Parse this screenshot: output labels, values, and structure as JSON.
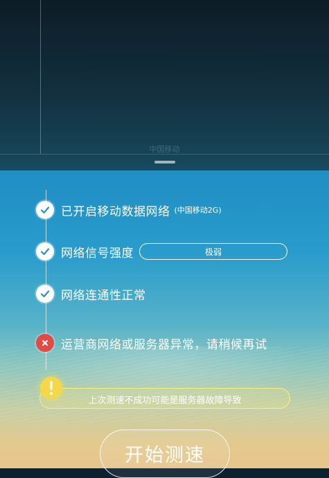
{
  "top_area": {
    "carrier_faint": "中国移动"
  },
  "steps": [
    {
      "status": "success",
      "icon": "checkmark-icon",
      "label": "已开启移动数据网络",
      "sub": "(中国移动2G)"
    },
    {
      "status": "success",
      "icon": "checkmark-icon",
      "label": "网络信号强度",
      "signal_value": "极弱"
    },
    {
      "status": "success",
      "icon": "checkmark-icon",
      "label": "网络连通性正常"
    },
    {
      "status": "error",
      "icon": "cross-icon",
      "label": "运营商网络或服务器异常，请稍候再试"
    }
  ],
  "warning": {
    "icon": "exclamation-icon",
    "text": "上次测速不成功可能是服务器故障导致"
  },
  "start_button": {
    "label": "开始测速"
  },
  "colors": {
    "accent_blue": "#2a9ccc",
    "error_red": "#e24b44",
    "warning_yellow": "#f4d84a",
    "check_blue": "#2b8fc0"
  }
}
